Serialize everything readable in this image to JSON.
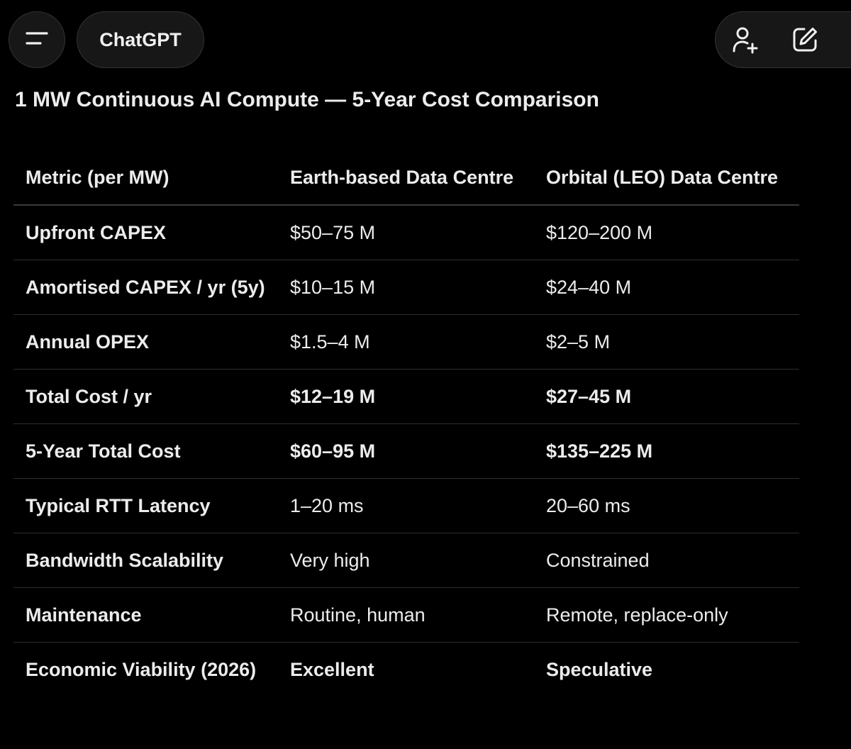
{
  "header": {
    "model_label": "ChatGPT",
    "icons": {
      "menu": "hamburger-menu-icon",
      "add_user": "add-user-icon",
      "new_chat": "edit-square-icon"
    }
  },
  "content": {
    "title": "1 MW Continuous AI Compute — 5-Year Cost Comparison",
    "table": {
      "headers": [
        "Metric (per MW)",
        "Earth-based Data Centre",
        "Orbital (LEO) Data Centre"
      ],
      "rows": [
        {
          "metric": "Upfront CAPEX",
          "earth": "$50–75 M",
          "orbital": "$120–200 M",
          "bold": false
        },
        {
          "metric": "Amortised CAPEX / yr (5y)",
          "earth": "$10–15 M",
          "orbital": "$24–40 M",
          "bold": false
        },
        {
          "metric": "Annual OPEX",
          "earth": "$1.5–4 M",
          "orbital": "$2–5 M",
          "bold": false
        },
        {
          "metric": "Total Cost / yr",
          "earth": "$12–19 M",
          "orbital": "$27–45 M",
          "bold": true
        },
        {
          "metric": "5-Year Total Cost",
          "earth": "$60–95 M",
          "orbital": "$135–225 M",
          "bold": true
        },
        {
          "metric": "Typical RTT Latency",
          "earth": "1–20 ms",
          "orbital": "20–60 ms",
          "bold": false
        },
        {
          "metric": "Bandwidth Scalability",
          "earth": "Very high",
          "orbital": "Constrained",
          "bold": false
        },
        {
          "metric": "Maintenance",
          "earth": "Routine, human",
          "orbital": "Remote, replace-only",
          "bold": false
        },
        {
          "metric": "Economic Viability (2026)",
          "earth": "Excellent",
          "orbital": "Speculative",
          "bold": true
        }
      ]
    }
  }
}
